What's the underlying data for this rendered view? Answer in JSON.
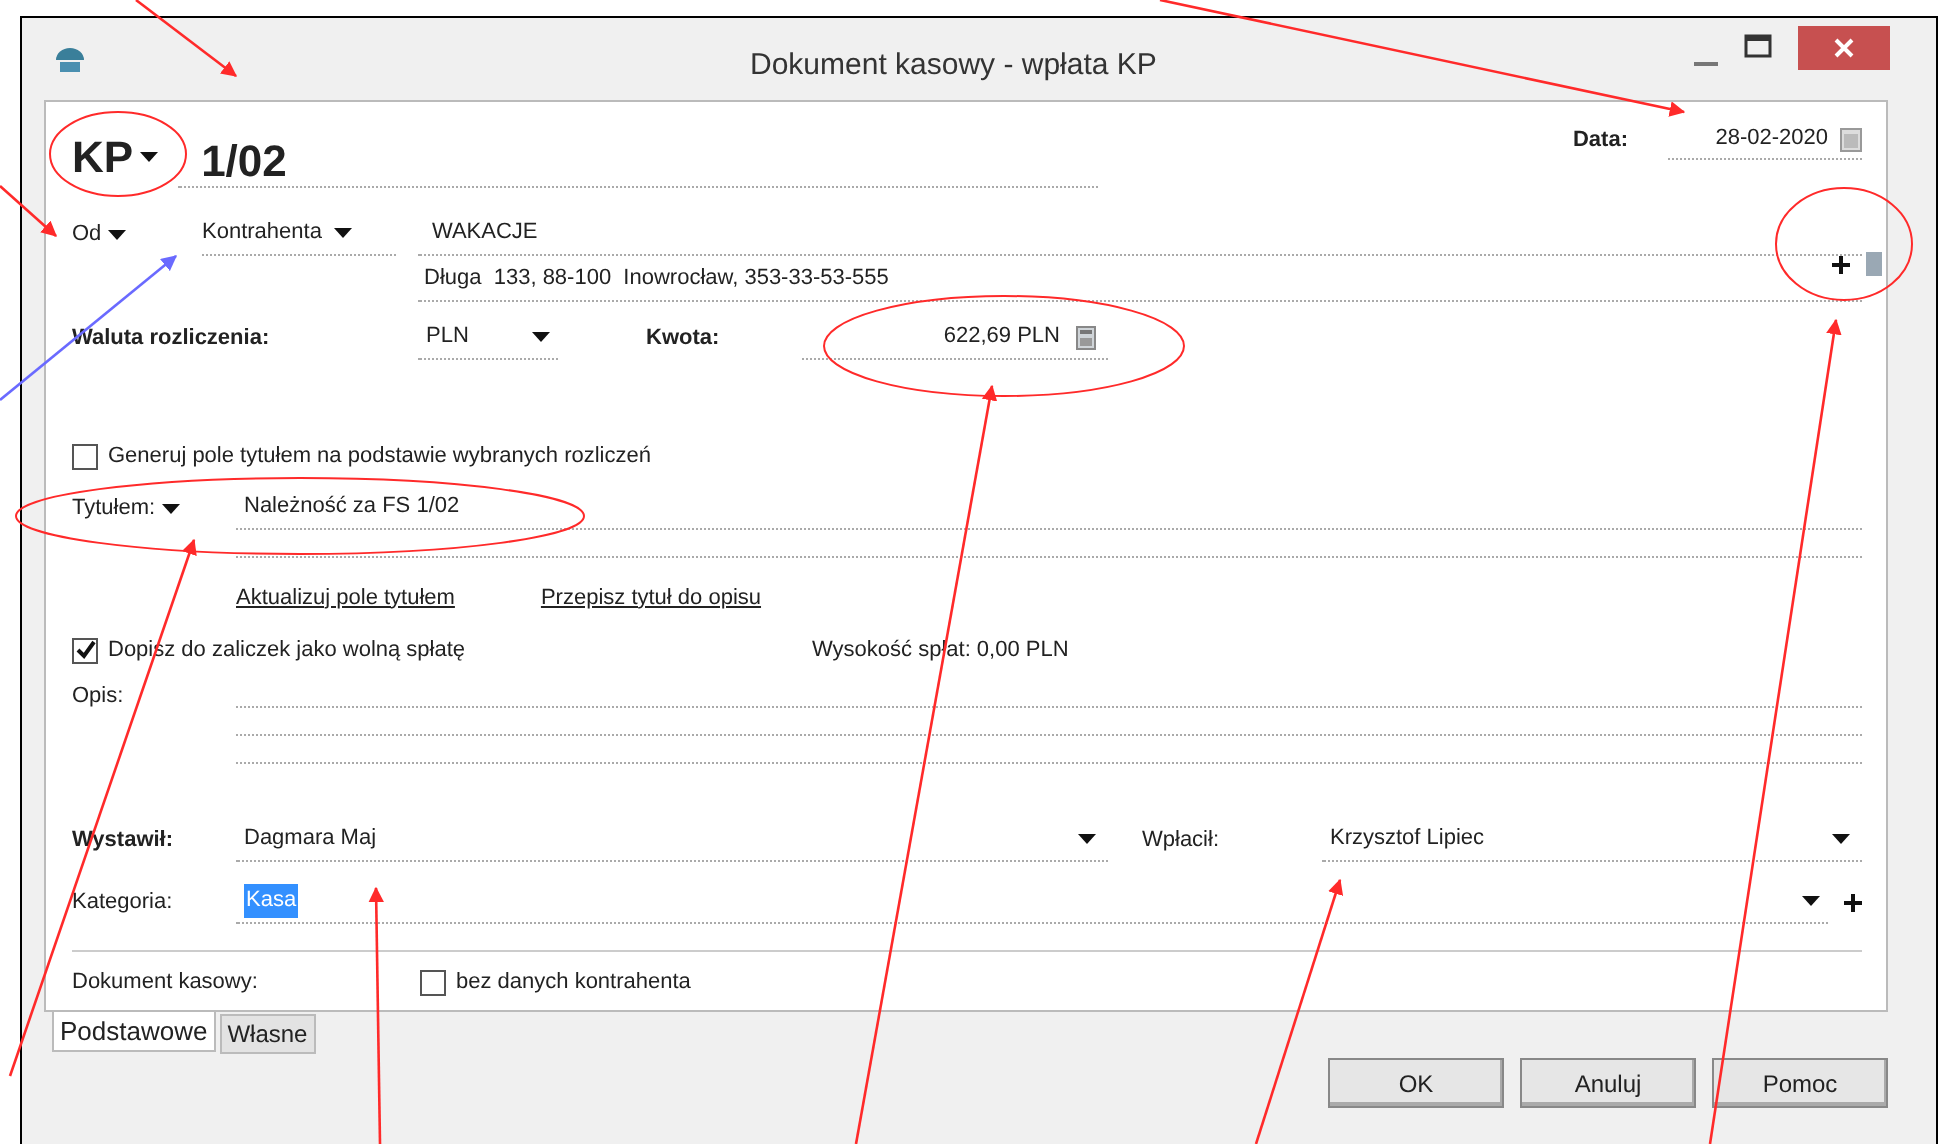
{
  "window": {
    "title": "Dokument kasowy - wpłata KP"
  },
  "header": {
    "doc_type": "KP",
    "number": "1/02",
    "date_label": "Data:",
    "date": "28-02-2020"
  },
  "party": {
    "direction": "Od",
    "type": "Kontrahenta",
    "name": "WAKACJE",
    "address": "Długa  133, 88-100  Inowrocław, 353-33-53-555"
  },
  "currency": {
    "label": "Waluta rozliczenia:",
    "value": "PLN"
  },
  "amount": {
    "label": "Kwota:",
    "value": "622,69 PLN"
  },
  "generate_title": {
    "label": "Generuj pole tytułem na podstawie wybranych rozliczeń",
    "checked": false
  },
  "title_field": {
    "label": "Tytułem:",
    "value": "Należność za FS 1/02"
  },
  "links": [
    "Aktualizuj pole tytułem",
    "Przepisz tytuł do opisu"
  ],
  "advance": {
    "label": "Dopisz do zaliczek jako wolną spłatę",
    "checked": true
  },
  "repayment": "Wysokość spłat: 0,00 PLN",
  "description": {
    "label": "Opis:"
  },
  "issuer": {
    "label": "Wystawił:",
    "value": "Dagmara Maj"
  },
  "payer": {
    "label": "Wpłacił:",
    "value": "Krzysztof Lipiec"
  },
  "category": {
    "label": "Kategoria:",
    "value": "Kasa",
    "selected": true
  },
  "document": {
    "label": "Dokument kasowy:",
    "no_party": {
      "label": "bez danych kontrahenta",
      "checked": false
    }
  },
  "tabs": [
    {
      "label": "Podstawowe",
      "selected": true
    },
    {
      "label": "Własne",
      "selected": false
    }
  ],
  "buttons": [
    "OK",
    "Anuluj",
    "Pomoc"
  ]
}
